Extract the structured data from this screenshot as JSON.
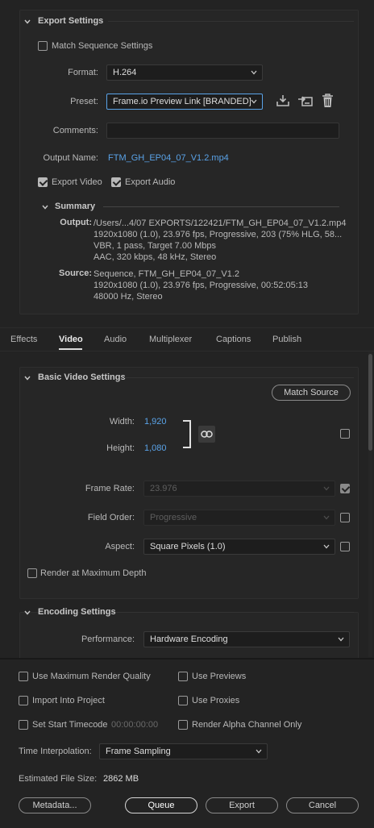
{
  "export_settings": {
    "title": "Export Settings",
    "match_sequence_label": "Match Sequence Settings",
    "format_label": "Format:",
    "format_value": "H.264",
    "preset_label": "Preset:",
    "preset_value": "Frame.io Preview Link [BRANDED]",
    "comments_label": "Comments:",
    "comments_value": "",
    "output_name_label": "Output Name:",
    "output_name_value": "FTM_GH_EP04_07_V1.2.mp4",
    "export_video_label": "Export Video",
    "export_audio_label": "Export Audio",
    "export_video_checked": true,
    "export_audio_checked": true,
    "match_sequence_checked": false
  },
  "summary": {
    "title": "Summary",
    "output_label": "Output:",
    "output_lines": [
      "/Users/...4/07 EXPORTS/122421/FTM_GH_EP04_07_V1.2.mp4",
      "1920x1080 (1.0), 23.976 fps, Progressive, 203 (75% HLG, 58...",
      "VBR, 1 pass, Target 7.00 Mbps",
      "AAC, 320 kbps, 48 kHz, Stereo"
    ],
    "source_label": "Source:",
    "source_lines": [
      "Sequence, FTM_GH_EP04_07_V1.2",
      "1920x1080 (1.0), 23.976 fps, Progressive, 00:52:05:13",
      "48000 Hz, Stereo"
    ]
  },
  "tabs": [
    "Effects",
    "Video",
    "Audio",
    "Multiplexer",
    "Captions",
    "Publish"
  ],
  "active_tab": "Video",
  "basic_video": {
    "title": "Basic Video Settings",
    "match_source_label": "Match Source",
    "width_label": "Width:",
    "width_value": "1,920",
    "height_label": "Height:",
    "height_value": "1,080",
    "frame_rate_label": "Frame Rate:",
    "frame_rate_value": "23.976",
    "field_order_label": "Field Order:",
    "field_order_value": "Progressive",
    "aspect_label": "Aspect:",
    "aspect_value": "Square Pixels (1.0)",
    "render_max_depth_label": "Render at Maximum Depth"
  },
  "encoding": {
    "title": "Encoding Settings",
    "performance_label": "Performance:",
    "performance_value": "Hardware Encoding"
  },
  "bottom": {
    "use_max_quality_label": "Use Maximum Render Quality",
    "use_previews_label": "Use Previews",
    "import_project_label": "Import Into Project",
    "use_proxies_label": "Use Proxies",
    "set_start_tc_label": "Set Start Timecode",
    "start_tc_value": "00:00:00:00",
    "render_alpha_label": "Render Alpha Channel Only",
    "time_interp_label": "Time Interpolation:",
    "time_interp_value": "Frame Sampling",
    "est_size_label": "Estimated File Size:",
    "est_size_value": "2862 MB",
    "metadata_label": "Metadata...",
    "queue_label": "Queue",
    "export_label": "Export",
    "cancel_label": "Cancel"
  },
  "colors": {
    "accent_blue": "#5aa3e8",
    "background": "#232323",
    "panel": "#262626"
  }
}
